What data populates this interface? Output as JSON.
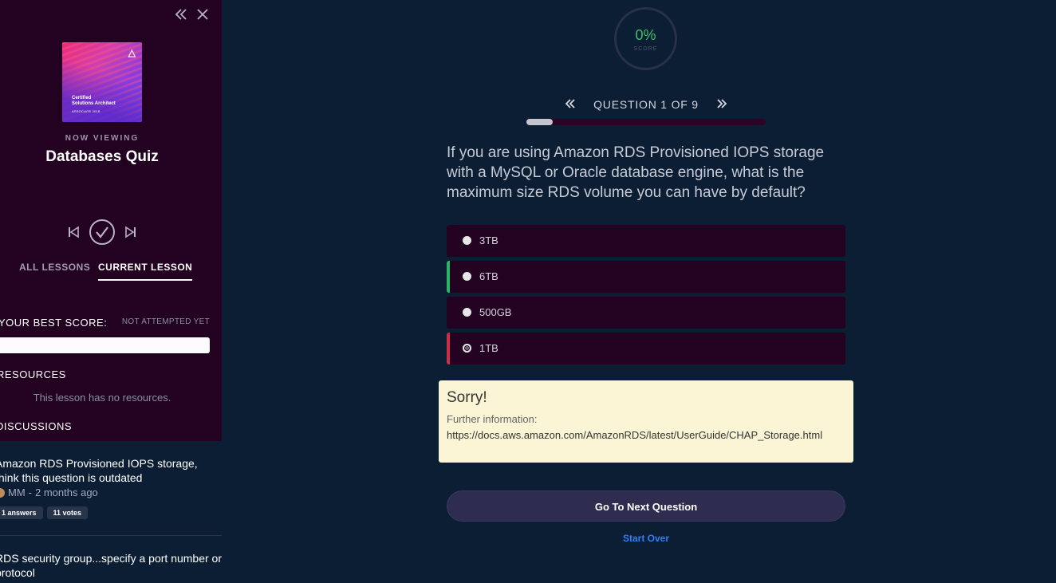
{
  "sidebar": {
    "cover": {
      "title_line1": "Certified",
      "title_line2": "Solutions Architect",
      "subtitle": "ASSOCIATE 2018"
    },
    "now_viewing_label": "NOW VIEWING",
    "lesson_title": "Databases Quiz",
    "tabs": [
      {
        "label": "ALL LESSONS",
        "active": false
      },
      {
        "label": "CURRENT LESSON",
        "active": true
      }
    ],
    "best_score_label": "YOUR BEST SCORE:",
    "best_score_status": "NOT ATTEMPTED YET",
    "resources_title": "RESOURCES",
    "resources_empty": "This lesson has no resources.",
    "discussions_title": "DISCUSSIONS",
    "discussions": [
      {
        "text": "Amazon RDS Provisioned IOPS storage, think this question is outdated",
        "author": "MM",
        "time": "2 months ago",
        "answers": "1 answers",
        "votes": "11 votes"
      },
      {
        "text": "RDS security group...specify a port number or protocol"
      }
    ]
  },
  "main": {
    "score_value": "0%",
    "score_label": "SCORE",
    "question_nav_label": "QUESTION 1 OF 9",
    "progress_fraction": 0.11,
    "question": "If you are using Amazon RDS Provisioned IOPS storage with a MySQL or Oracle database engine, what is the maximum size RDS volume you can have by default?",
    "answers": [
      {
        "label": "3TB",
        "state": "none"
      },
      {
        "label": "6TB",
        "state": "correct"
      },
      {
        "label": "500GB",
        "state": "none"
      },
      {
        "label": "1TB",
        "state": "wrong",
        "selected": true
      }
    ],
    "feedback": {
      "title": "Sorry!",
      "info": "Further information:",
      "link": "https://docs.aws.amazon.com/AmazonRDS/latest/UserGuide/CHAP_Storage.html"
    },
    "next_button_label": "Go To Next Question",
    "start_over_label": "Start Over"
  },
  "colors": {
    "sidebar_bg": "#230121",
    "page_bg": "#0b1e33",
    "correct": "#29b563",
    "wrong": "#cc2e47",
    "score_green": "#3fbf6d",
    "link_blue": "#2f7ef5",
    "feedback_bg": "#fbf5d5"
  },
  "icons": [
    "collapse-icon",
    "close-icon",
    "skip-previous-icon",
    "check-circle-icon",
    "skip-next-icon",
    "chevron-double-left-icon",
    "chevron-double-right-icon"
  ]
}
